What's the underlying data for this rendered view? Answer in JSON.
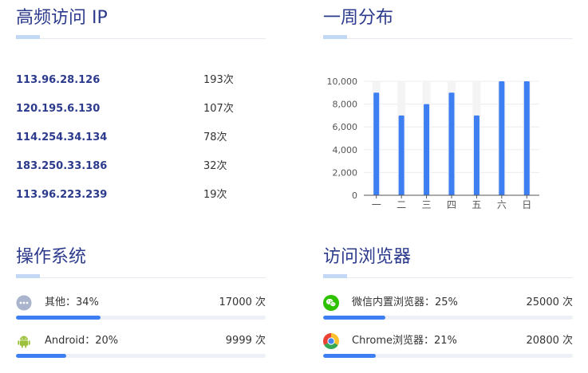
{
  "ip_panel": {
    "title": "高频访问 IP",
    "rows": [
      {
        "ip": "113.96.28.126",
        "count": "193次"
      },
      {
        "ip": "120.195.6.130",
        "count": "107次"
      },
      {
        "ip": "114.254.34.134",
        "count": "78次"
      },
      {
        "ip": "183.250.33.186",
        "count": "32次"
      },
      {
        "ip": "113.96.223.239",
        "count": "19次"
      }
    ]
  },
  "week_panel": {
    "title": "一周分布"
  },
  "chart_data": {
    "type": "bar",
    "categories": [
      "一",
      "二",
      "三",
      "四",
      "五",
      "六",
      "日"
    ],
    "values": [
      9000,
      7000,
      8000,
      9000,
      7000,
      10000,
      10000
    ],
    "ylim": [
      0,
      10000
    ],
    "yticks": [
      "0",
      "2,000",
      "4,000",
      "6,000",
      "8,000",
      "10,000"
    ],
    "grid": true,
    "bar_color": "#3d7ff2"
  },
  "os_panel": {
    "title": "操作系统",
    "items": [
      {
        "label": "其他：34%",
        "value": "17000 次",
        "percent": 34,
        "icon": "more-dots-icon"
      },
      {
        "label": "Android：20%",
        "value": "9999 次",
        "percent": 20,
        "icon": "android-icon"
      }
    ]
  },
  "browser_panel": {
    "title": "访问浏览器",
    "items": [
      {
        "label": "微信内置浏览器：25%",
        "value": "25000 次",
        "percent": 25,
        "icon": "wechat-icon"
      },
      {
        "label": "Chrome浏览器：21%",
        "value": "20800 次",
        "percent": 21,
        "icon": "chrome-icon"
      }
    ]
  },
  "colors": {
    "accent": "#3d7ff2",
    "title": "#2b3a8c",
    "track": "#eef0f7"
  }
}
